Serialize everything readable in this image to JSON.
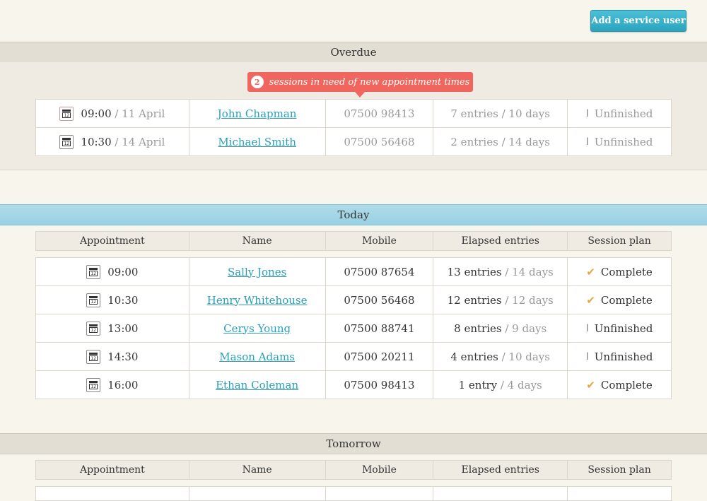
{
  "header": {
    "add_button": "Add a service user"
  },
  "overdue": {
    "title": "Overdue",
    "callout_count": "2",
    "callout_text": "sessions in need of new appointment times",
    "rows": [
      {
        "time": "09:00",
        "date": "/ 11 April",
        "name": "John Chapman",
        "mobile": "07500 98413",
        "entries": "7 entries",
        "days": "/ 10 days",
        "plan": "Unfinished"
      },
      {
        "time": "10:30",
        "date": "/ 14 April",
        "name": "Michael Smith",
        "mobile": "07500 56468",
        "entries": "2 entries",
        "days": "/ 14 days",
        "plan": "Unfinished"
      }
    ]
  },
  "columns": [
    "Appointment",
    "Name",
    "Mobile",
    "Elapsed entries",
    "Session plan"
  ],
  "today": {
    "title": "Today",
    "rows": [
      {
        "time": "09:00",
        "name": "Sally Jones",
        "mobile": "07500 87654",
        "entries": "13 entries",
        "days": "/ 14 days",
        "plan": "Complete",
        "plan_icon": "check-icon"
      },
      {
        "time": "10:30",
        "name": "Henry Whitehouse",
        "mobile": "07500 56468",
        "entries": "12 entries",
        "days": "/ 12 days",
        "plan": "Complete",
        "plan_icon": "check-icon"
      },
      {
        "time": "13:00",
        "name": "Cerys Young",
        "mobile": "07500 88741",
        "entries": "8 entries",
        "days": "/ 9 days",
        "plan": "Unfinished",
        "plan_icon": "unfinished-icon"
      },
      {
        "time": "14:30",
        "name": "Mason Adams",
        "mobile": "07500 20211",
        "entries": "4 entries",
        "days": "/ 10 days",
        "plan": "Unfinished",
        "plan_icon": "unfinished-icon"
      },
      {
        "time": "16:00",
        "name": "Ethan Coleman",
        "mobile": "07500 98413",
        "entries": "1 entry",
        "days": "/ 4 days",
        "plan": "Complete",
        "plan_icon": "check-icon"
      }
    ]
  },
  "tomorrow": {
    "title": "Tomorrow"
  },
  "colors": {
    "accent": "#2a9fb8",
    "alert": "#f0665e",
    "check": "#e3a83b"
  }
}
